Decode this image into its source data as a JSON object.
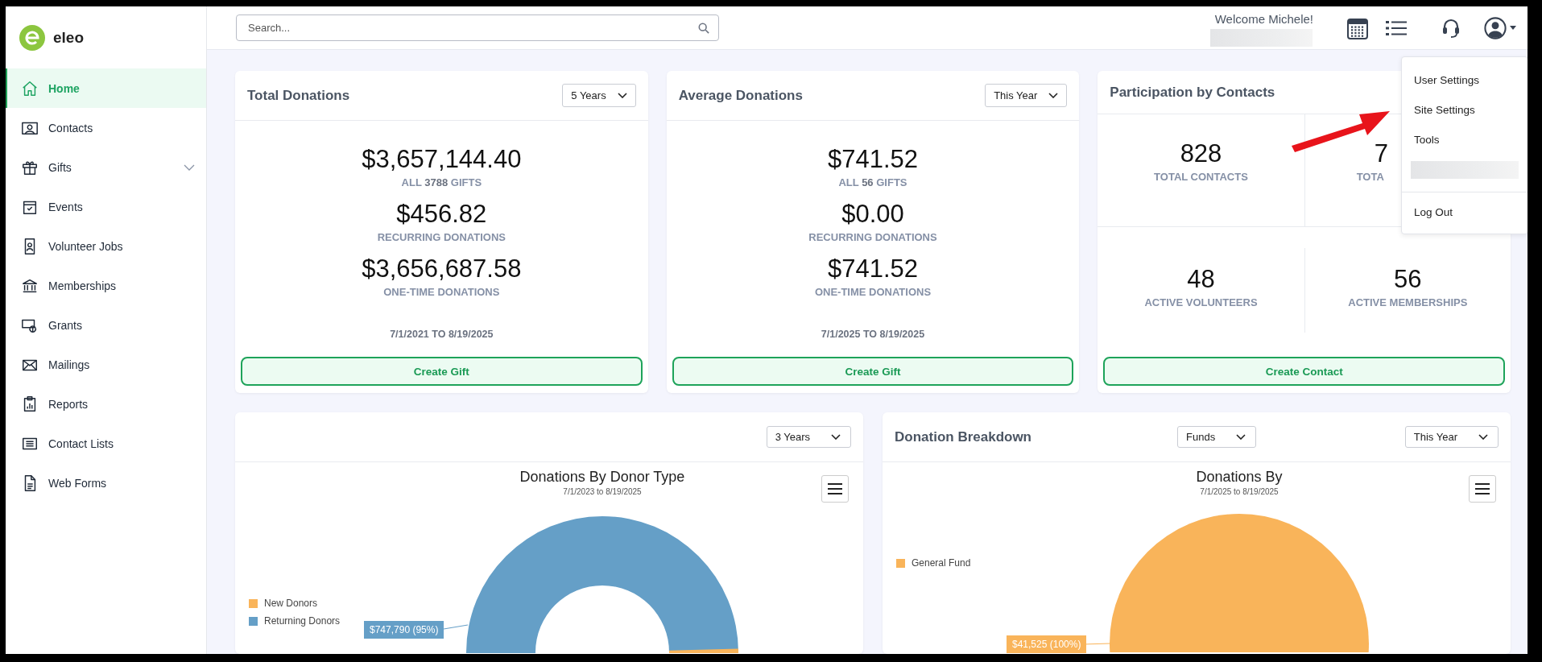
{
  "sidebar": {
    "logo": "eleo",
    "items": [
      {
        "label": "Home",
        "selected": true,
        "expandable": false
      },
      {
        "label": "Contacts",
        "selected": false,
        "expandable": false
      },
      {
        "label": "Gifts",
        "selected": false,
        "expandable": true
      },
      {
        "label": "Events",
        "selected": false,
        "expandable": false
      },
      {
        "label": "Volunteer Jobs",
        "selected": false,
        "expandable": false
      },
      {
        "label": "Memberships",
        "selected": false,
        "expandable": false
      },
      {
        "label": "Grants",
        "selected": false,
        "expandable": false
      },
      {
        "label": "Mailings",
        "selected": false,
        "expandable": false
      },
      {
        "label": "Reports",
        "selected": false,
        "expandable": false
      },
      {
        "label": "Contact Lists",
        "selected": false,
        "expandable": false
      },
      {
        "label": "Web Forms",
        "selected": false,
        "expandable": false
      }
    ]
  },
  "header": {
    "search": {
      "placeholder": "Search..."
    },
    "welcome": "Welcome Michele!"
  },
  "user_menu": {
    "items": [
      {
        "kind": "link",
        "label": "User Settings"
      },
      {
        "kind": "link",
        "label": "Site Settings"
      },
      {
        "kind": "link",
        "label": "Tools"
      },
      {
        "kind": "redacted"
      },
      {
        "kind": "divider"
      },
      {
        "kind": "link",
        "label": "Log Out"
      }
    ]
  },
  "summary_cards": [
    {
      "title": "Total Donations",
      "period": "5 Years",
      "stats": [
        {
          "value": "$3,657,144.40",
          "label": "ALL **3788** GIFTS"
        },
        {
          "value": "$456.82",
          "label": "RECURRING DONATIONS"
        },
        {
          "value": "$3,656,687.58",
          "label": "ONE-TIME DONATIONS"
        }
      ],
      "date_range": "7/1/2021 TO 8/19/2025",
      "button": "Create Gift"
    },
    {
      "title": "Average Donations",
      "period": "This Year",
      "stats": [
        {
          "value": "$741.52",
          "label": "ALL **56** GIFTS"
        },
        {
          "value": "$0.00",
          "label": "RECURRING DONATIONS"
        },
        {
          "value": "$741.52",
          "label": "ONE-TIME DONATIONS"
        }
      ],
      "date_range": "7/1/2025 TO 8/19/2025",
      "button": "Create Gift"
    }
  ],
  "participation_card": {
    "title": "Participation by Contacts",
    "stats": [
      {
        "kind": "full",
        "value": "828",
        "label": "TOTAL CONTACTS"
      },
      {
        "kind": "partial",
        "value": "7",
        "label": "TOTA"
      },
      {
        "kind": "full",
        "value": "48",
        "label": "ACTIVE VOLUNTEERS"
      },
      {
        "kind": "full",
        "value": "56",
        "label": "ACTIVE MEMBERSHIPS"
      }
    ],
    "button": "Create Contact"
  },
  "chart_cards": [
    {
      "filters": [
        "3 Years"
      ],
      "chart": {
        "kind": "donut",
        "title": "Donations By Donor Type",
        "subtitle": "7/1/2023 to 8/19/2025",
        "legend": [
          {
            "label": "New Donors",
            "color": "#f9b45a"
          },
          {
            "label": "Returning Donors",
            "color": "#659fc7"
          }
        ],
        "slice_label": "$747,790 (95%)"
      }
    },
    {
      "title": "Donation Breakdown",
      "filters": [
        "Funds",
        "This Year"
      ],
      "chart": {
        "kind": "pie",
        "title": "Donations By",
        "subtitle": "7/1/2025 to 8/19/2025",
        "legend": [
          {
            "label": "General Fund",
            "color": "#f9b45a"
          }
        ],
        "slice_label": "$41,525 (100%)"
      }
    }
  ]
}
